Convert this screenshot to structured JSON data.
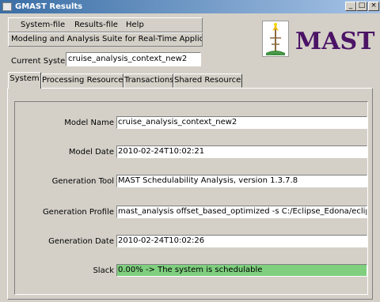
{
  "window": {
    "title": "GMAST Results",
    "controls": {
      "minimize": "_",
      "maximize": "□",
      "close": "×"
    }
  },
  "menu": {
    "items": [
      {
        "label": "System-file"
      },
      {
        "label": "Results-file"
      },
      {
        "label": "Help"
      }
    ]
  },
  "header": {
    "suite_name": "Modeling and Analysis Suite for Real-Time Applications",
    "current_system_label": "Current System",
    "current_system_value": "cruise_analysis_context_new2",
    "logo_text": "MAST"
  },
  "tabs": [
    {
      "label": "System",
      "active": true
    },
    {
      "label": "Processing Resources",
      "active": false
    },
    {
      "label": "Transactions",
      "active": false
    },
    {
      "label": "Shared Resources",
      "active": false
    }
  ],
  "system": {
    "fields": [
      {
        "label": "Model Name",
        "value": "cruise_analysis_context_new2"
      },
      {
        "label": "Model Date",
        "value": "2010-02-24T10:02:21"
      },
      {
        "label": "Generation Tool",
        "value": "MAST Schedulability Analysis, version 1.3.7.8"
      },
      {
        "label": "Generation Profile",
        "value": "mast_analysis offset_based_optimized -s C:/Eclipse_Edona/eclipse/works"
      },
      {
        "label": "Generation Date",
        "value": "2010-02-24T10:02:26"
      },
      {
        "label": "Slack",
        "value": "0.00% -> The system is schedulable"
      }
    ],
    "slack_color": "#7fcf7f"
  },
  "colors": {
    "logo_text": "#4b1366",
    "titlebar_start": "#3a6ea5",
    "face": "#d4d0c8"
  },
  "icons": {
    "app": "app-icon",
    "logo": "mast-logo-icon"
  }
}
